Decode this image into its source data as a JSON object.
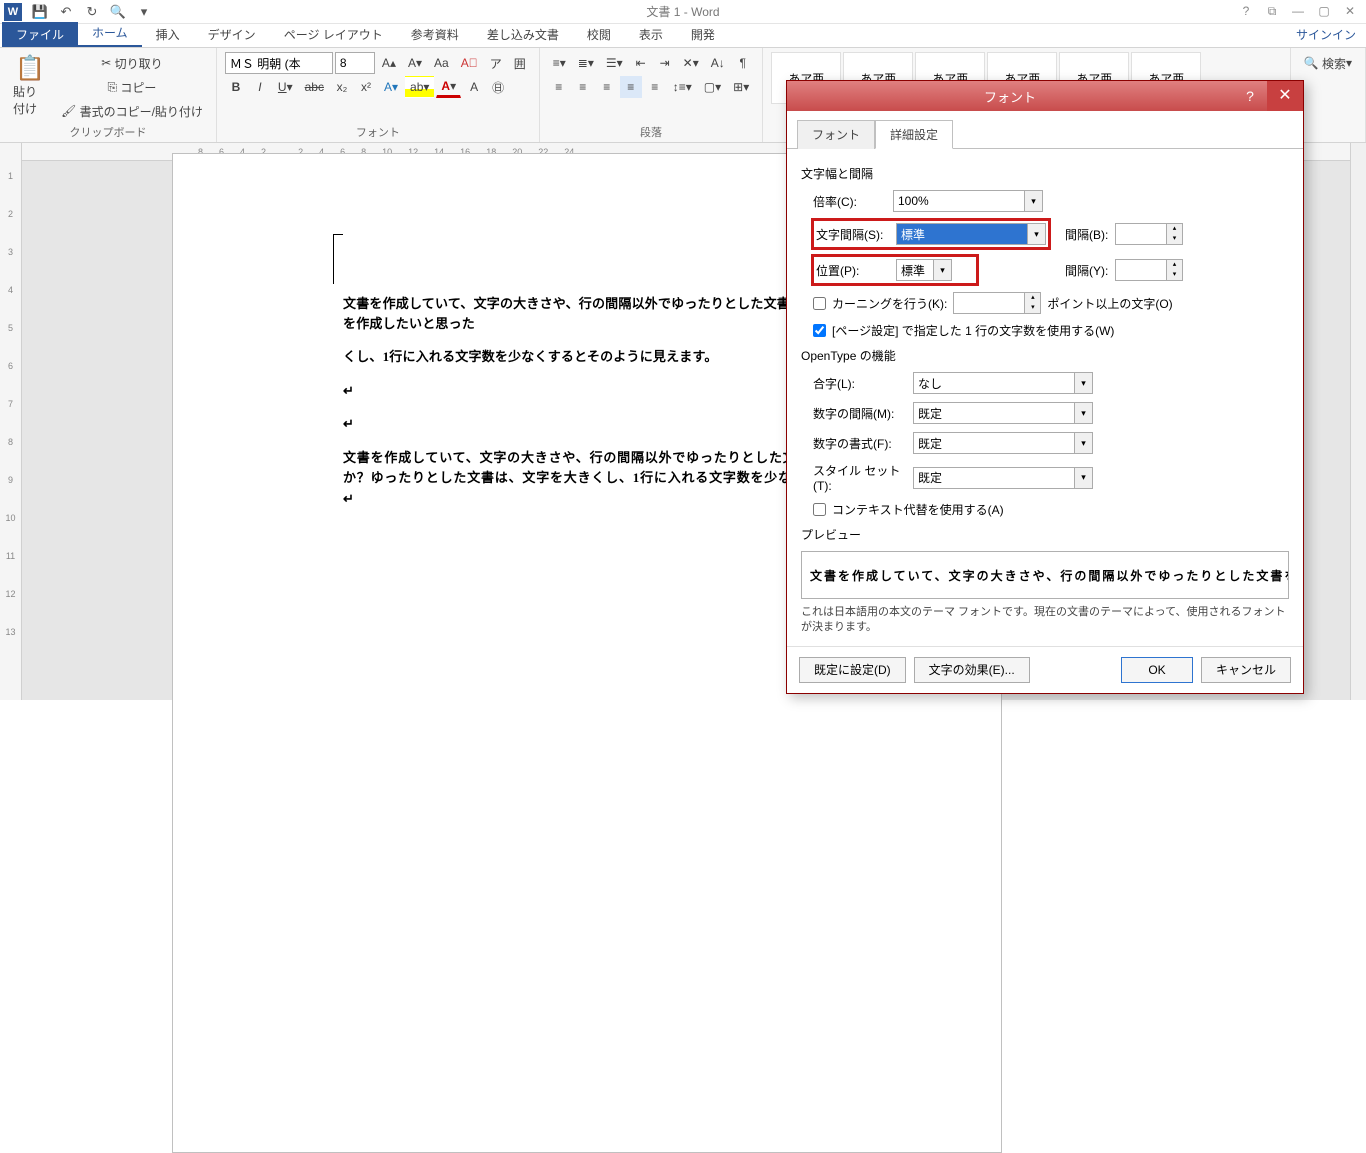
{
  "title": "文書 1 - Word",
  "signin": "サインイン",
  "tabs": {
    "file": "ファイル",
    "home": "ホーム",
    "insert": "挿入",
    "design": "デザイン",
    "layout": "ページ レイアウト",
    "references": "参考資料",
    "mailings": "差し込み文書",
    "review": "校閲",
    "view": "表示",
    "developer": "開発"
  },
  "clipboard": {
    "paste": "貼り付け",
    "cut": "切り取り",
    "copy": "コピー",
    "formatpainter": "書式のコピー/貼り付け",
    "group": "クリップボード"
  },
  "font": {
    "name": "ＭＳ 明朝 (本",
    "size": "8",
    "group": "フォント"
  },
  "paragraph": {
    "group": "段落"
  },
  "styles": {
    "preview": "あア亜",
    "find": "検索"
  },
  "ruler": {
    "ticks": [
      "8",
      "6",
      "4",
      "2",
      "",
      "2",
      "4",
      "6",
      "8",
      "10",
      "12",
      "14",
      "16",
      "18",
      "20",
      "22",
      "24"
    ]
  },
  "document": {
    "p1": "文書を作成していて、文字の大きさや、行の間隔以外でゆったりとした文書を作成したいと思った",
    "p2": "くし、1行に入れる文字数を少なくするとそのように見えます。",
    "p3": "文書を作成していて、文字の大きさや、行の間隔以外でゆったりとした文",
    "p4": "か？ゆったりとした文書は、文字を大きくし、1行に入れる文字数を少な"
  },
  "dialog": {
    "title": "フォント",
    "tab_font": "フォント",
    "tab_advanced": "詳細設定",
    "section_spacing": "文字幅と間隔",
    "scale_label": "倍率(C):",
    "scale_value": "100%",
    "spacing_label": "文字間隔(S):",
    "spacing_value": "標準",
    "spacing_by_label": "間隔(B):",
    "position_label": "位置(P):",
    "position_value": "標準",
    "position_by_label": "間隔(Y):",
    "kerning_label": "カーニングを行う(K):",
    "kerning_after": "ポイント以上の文字(O)",
    "grid_label": "[ページ設定] で指定した 1 行の文字数を使用する(W)",
    "section_opentype": "OpenType の機能",
    "ligatures_label": "合字(L):",
    "ligatures_value": "なし",
    "numspacing_label": "数字の間隔(M):",
    "numspacing_value": "既定",
    "numforms_label": "数字の書式(F):",
    "numforms_value": "既定",
    "styleset_label": "スタイル セット(T):",
    "styleset_value": "既定",
    "context_label": "コンテキスト代替を使用する(A)",
    "section_preview": "プレビュー",
    "preview_text": "文書を作成していて、文字の大きさや、行の間隔以外でゆったりとした文書を作成",
    "note": "これは日本語用の本文のテーマ フォントです。現在の文書のテーマによって、使用されるフォントが決まります。",
    "set_default": "既定に設定(D)",
    "text_effects": "文字の効果(E)...",
    "ok": "OK",
    "cancel": "キャンセル"
  }
}
